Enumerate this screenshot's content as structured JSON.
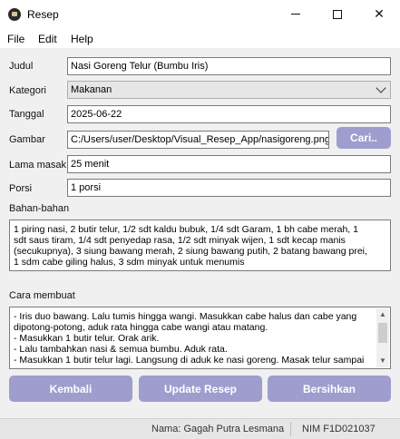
{
  "window": {
    "title": "Resep",
    "icon": "app-icon",
    "controls": [
      "minimize-icon",
      "maximize-icon",
      "close-icon"
    ]
  },
  "menu": {
    "items": [
      "File",
      "Edit",
      "Help"
    ]
  },
  "form": {
    "judul": {
      "label": "Judul",
      "value": "Nasi Goreng Telur (Bumbu Iris)"
    },
    "kategori": {
      "label": "Kategori",
      "value": "Makanan"
    },
    "tanggal": {
      "label": "Tanggal",
      "value": "2025-06-22"
    },
    "gambar": {
      "label": "Gambar",
      "value": "C:/Users/user/Desktop/Visual_Resep_App/nasigoreng.png",
      "button": "Cari.."
    },
    "lama_masak": {
      "label": "Lama masak",
      "value": "25 menit"
    },
    "porsi": {
      "label": "Porsi",
      "value": "1 porsi"
    },
    "bahan": {
      "label": "Bahan-bahan",
      "lines": [
        "1 piring nasi, 2  butir telur, 1/2 sdt kaldu bubuk, 1/4 sdt Garam, 1 bh cabe merah, 1",
        "sdt saus tiram, 1/4 sdt penyedap rasa, 1/2 sdt minyak wijen, 1 sdt kecap manis",
        "(secukupnya), 3 siung bawang merah, 2 siung bawang putih, 2 batang bawang prei,",
        "1 sdm cabe giling halus, 3 sdm minyak untuk menumis"
      ]
    },
    "cara": {
      "label": "Cara membuat",
      "lines": [
        "- Iris duo bawang. Lalu tumis hingga wangi. Masukkan cabe halus dan cabe yang",
        "dipotong-potong, aduk rata hingga cabe wangi atau matang.",
        "- Masukkan 1 butir telur. Orak arik.",
        "- Lalu tambahkan nasi & semua bumbu. Aduk rata.",
        "- Masukkan 1 butir telur lagi. Langsung di aduk ke nasi goreng. Masak telur sampai"
      ]
    }
  },
  "buttons": {
    "kembali": "Kembali",
    "update": "Update Resep",
    "bersihkan": "Bersihkan"
  },
  "status": {
    "name": "Nama: Gagah Putra Lesmana",
    "nim": "NIM F1D021037"
  },
  "colors": {
    "button_bg": "#9e9dce",
    "button_text": "#ffffff"
  }
}
